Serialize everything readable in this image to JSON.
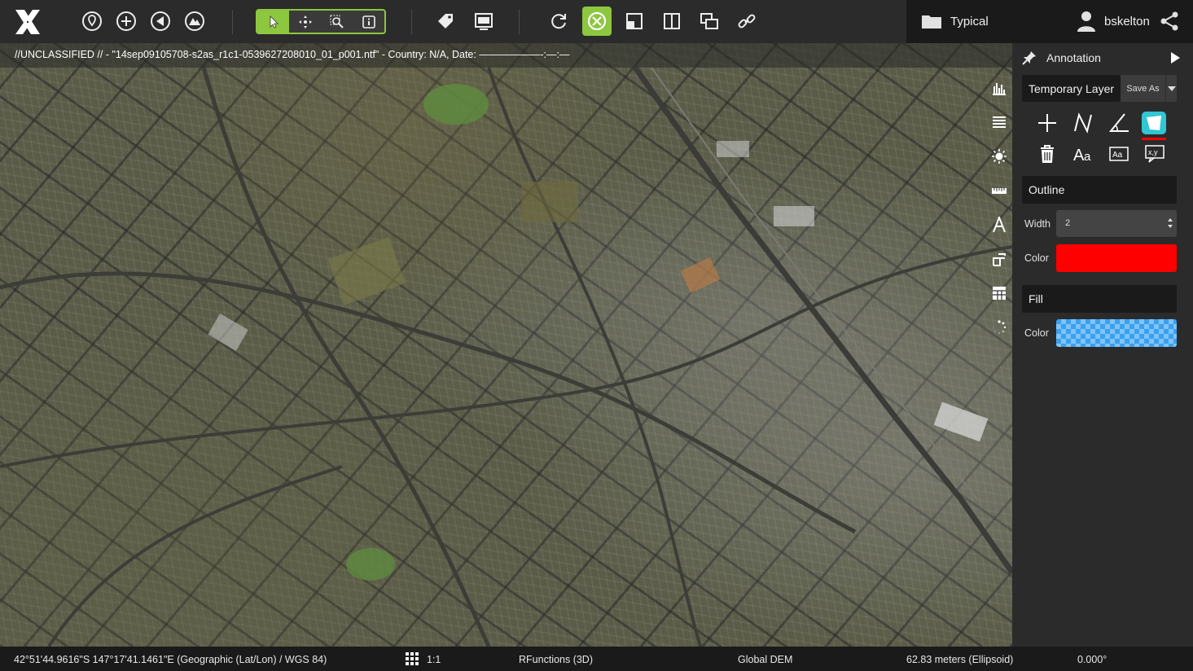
{
  "toolbar": {
    "logo": "x-logo",
    "buttons": [
      "map-pin-icon",
      "add-circle-icon",
      "navigate-icon",
      "terrain-icon"
    ],
    "modes": [
      "select-icon",
      "pan-icon",
      "zoom-icon",
      "info-icon"
    ],
    "active_mode": "select-icon",
    "tools": [
      "tag-icon",
      "screen-icon",
      "sync-icon",
      "crosshair-icon",
      "split-corner-icon",
      "split-vertical-icon",
      "overlap-icon",
      "link-icon"
    ],
    "active_tool": "crosshair-icon",
    "accent_color": "#8dc63f"
  },
  "workspace": {
    "name": "Typical",
    "icon": "folder-icon"
  },
  "user": {
    "name": "bskelton",
    "icon": "user-icon",
    "share_icon": "share-icon"
  },
  "map": {
    "classification": "//UNCLASSIFIED // - \"14sep09105708-s2as_r1c1-0539627208010_01_p001.ntf\" - Country: N/A, Date: ——————-:—:—",
    "side_tools": [
      "histogram-icon",
      "layers-icon",
      "brightness-icon",
      "ruler-icon",
      "text-icon",
      "crop-icon",
      "grid-table-icon",
      "loading-icon"
    ]
  },
  "panel": {
    "title": "Annotation",
    "layer": "Temporary Layer",
    "save_as": "Save As",
    "tools_row1": [
      "plus-icon",
      "polyline-icon",
      "angle-icon",
      "polygon-icon"
    ],
    "tools_row2": [
      "delete-icon",
      "font-icon",
      "text-box-icon",
      "xy-label-icon"
    ],
    "selected_tool": "polygon-icon",
    "outline": {
      "title": "Outline",
      "width_label": "Width",
      "width_value": "2",
      "color_label": "Color",
      "color": "#ff0000"
    },
    "fill": {
      "title": "Fill",
      "color_label": "Color",
      "color": "#3aa0f0"
    }
  },
  "status": {
    "coordinates": "42°51'44.9616\"S 147°17'41.1461\"E (Geographic (Lat/Lon) / WGS 84)",
    "scale": "1:1",
    "functions": "RFunctions (3D)",
    "elevation": "Global DEM",
    "height": "62.83 meters (Ellipsoid)",
    "rotation": "0.000°"
  }
}
